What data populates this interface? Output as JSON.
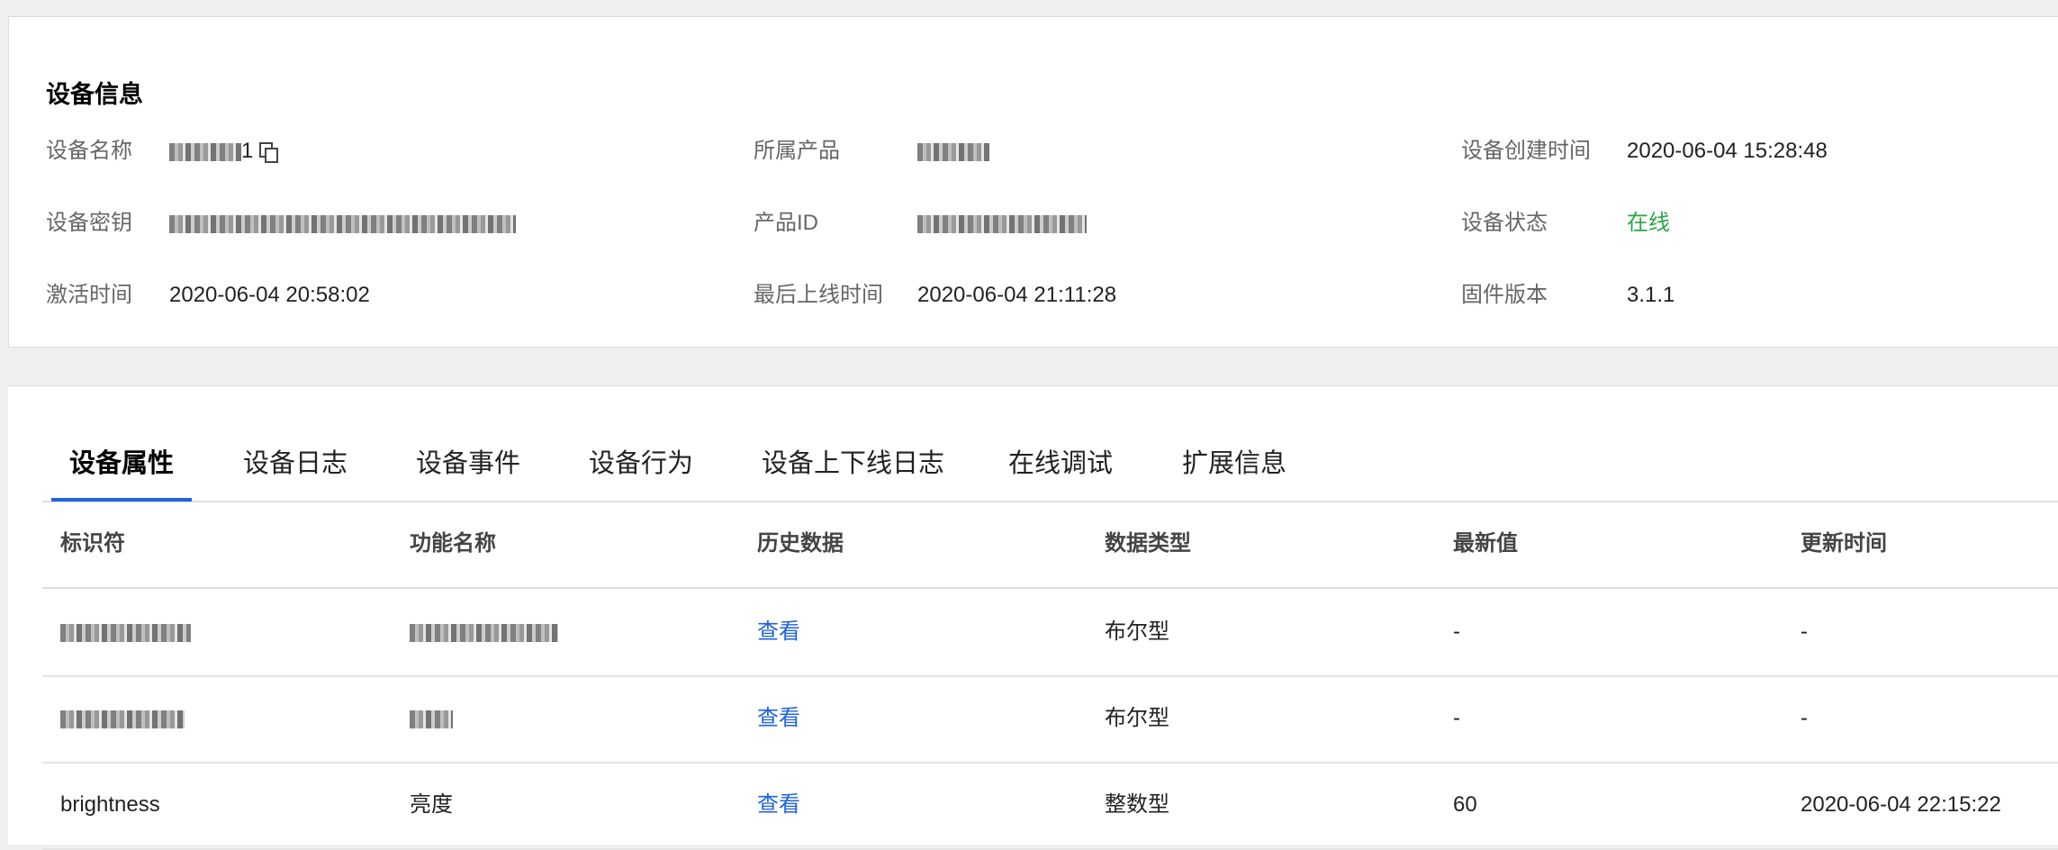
{
  "device_info": {
    "title": "设备信息",
    "labels": {
      "device_name": "设备名称",
      "device_secret": "设备密钥",
      "activation_time": "激活时间",
      "product": "所属产品",
      "product_id": "产品ID",
      "last_online_time": "最后上线时间",
      "create_time": "设备创建时间",
      "device_status": "设备状态",
      "firmware_version": "固件版本"
    },
    "values": {
      "device_name_suffix": "1",
      "activation_time": "2020-06-04 20:58:02",
      "last_online_time": "2020-06-04 21:11:28",
      "create_time": "2020-06-04 15:28:48",
      "device_status": "在线",
      "firmware_version": "3.1.1"
    },
    "status_color": "#29a745"
  },
  "tabs": [
    {
      "label": "设备属性",
      "active": true
    },
    {
      "label": "设备日志"
    },
    {
      "label": "设备事件"
    },
    {
      "label": "设备行为"
    },
    {
      "label": "设备上下线日志"
    },
    {
      "label": "在线调试"
    },
    {
      "label": "扩展信息"
    }
  ],
  "table": {
    "headers": [
      "标识符",
      "功能名称",
      "历史数据",
      "数据类型",
      "最新值",
      "更新时间"
    ],
    "rows": [
      {
        "identifier": "",
        "name": "",
        "history": "查看",
        "type": "布尔型",
        "latest": "-",
        "updated": "-"
      },
      {
        "identifier": "",
        "name": "",
        "history": "查看",
        "type": "布尔型",
        "latest": "-",
        "updated": "-"
      },
      {
        "identifier": "brightness",
        "name": "亮度",
        "history": "查看",
        "type": "整数型",
        "latest": "60",
        "updated": "2020-06-04 22:15:22"
      }
    ]
  },
  "accent_color": "#1f62e0"
}
